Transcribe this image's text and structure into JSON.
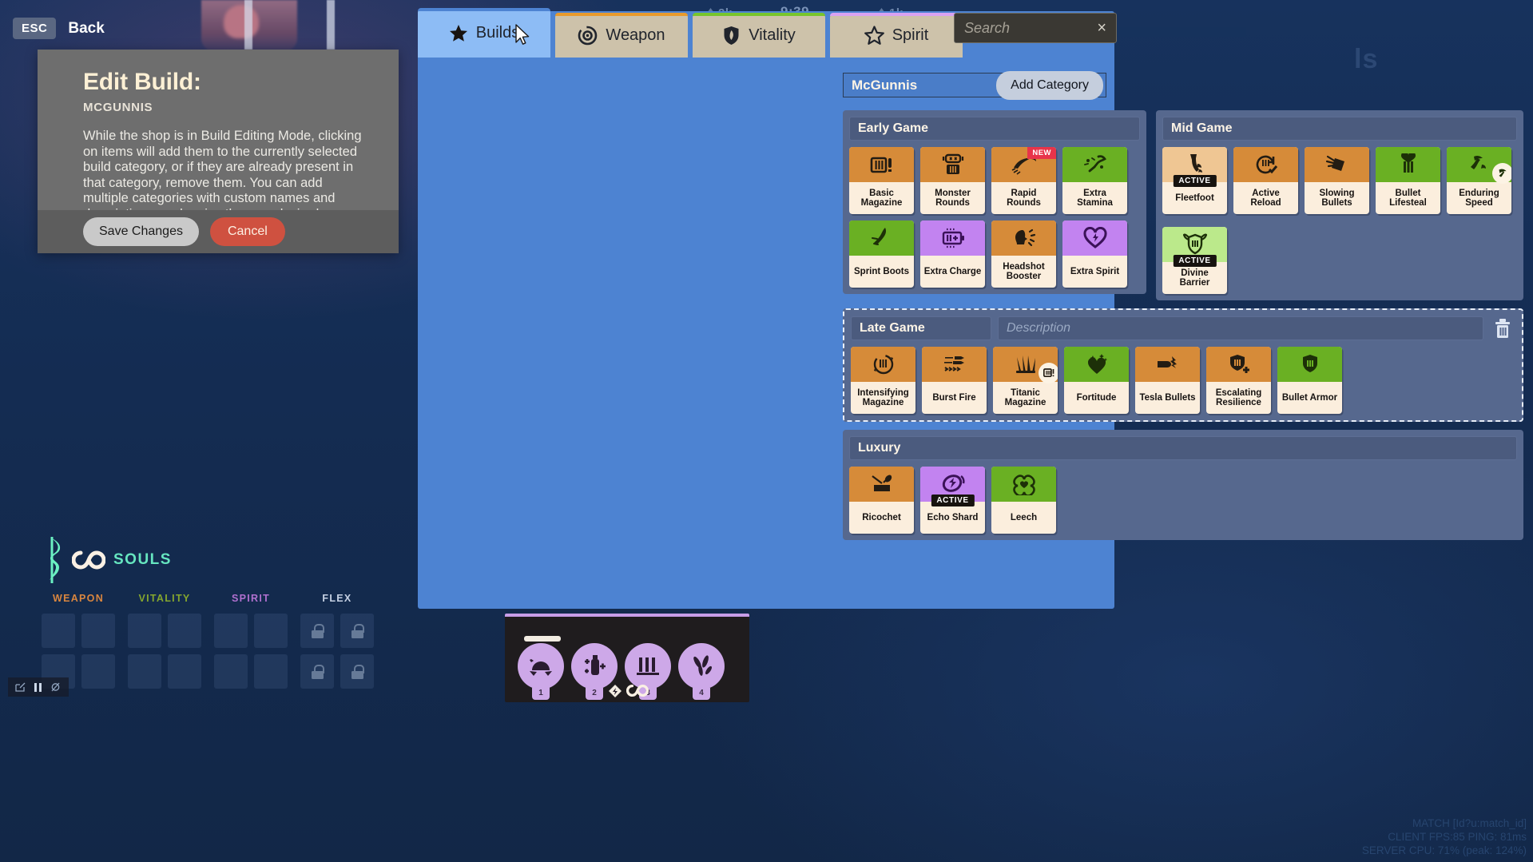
{
  "hud": {
    "souls_left": "2k",
    "souls_right": "1k",
    "clock": "9:39",
    "ghost_text": "ls",
    "souls_label": "SOULS",
    "stat_categories": [
      "WEAPON",
      "VITALITY",
      "SPIRIT",
      "FLEX"
    ],
    "ability_keys": [
      "1",
      "2",
      "3",
      "4"
    ],
    "debug_line1": "MATCH  [Id?u:match_id]",
    "debug_line2": "CLIENT FPS:85   PING: 81ms",
    "debug_line3": "SERVER CPU: 71% (peak: 124%)"
  },
  "escape": {
    "key": "ESC",
    "label": "Back"
  },
  "modal": {
    "title": "Edit Build:",
    "subtitle": "MCGUNNIS",
    "body": "While the shop is in Build Editing Mode, clicking on items will add them to the currently selected build category, or if they are already present in that category, remove them.  You can add multiple categories with custom names and descriptions, and resize them as desired.",
    "save_label": "Save Changes",
    "cancel_label": "Cancel"
  },
  "tabs": [
    {
      "label": "Builds",
      "icon": "star-filled-icon",
      "accent": "#4d83d2",
      "active": true
    },
    {
      "label": "Weapon",
      "icon": "weapon-icon",
      "accent": "#e89a2c",
      "active": false
    },
    {
      "label": "Vitality",
      "icon": "shield-icon",
      "accent": "#77c52c",
      "active": false
    },
    {
      "label": "Spirit",
      "icon": "star-outline-icon",
      "accent": "#d9a2f2",
      "active": false
    }
  ],
  "search": {
    "placeholder": "Search",
    "clear": "×"
  },
  "build": {
    "name": "McGunnis",
    "add_category_label": "Add Category"
  },
  "categories": [
    {
      "title": "Early Game",
      "editing": false,
      "items": [
        {
          "name": "Basic Magazine",
          "type": "weapon",
          "icon": "magazine-icon",
          "badge": ""
        },
        {
          "name": "Monster Rounds",
          "type": "weapon",
          "icon": "monster-icon",
          "badge": ""
        },
        {
          "name": "Rapid Rounds",
          "type": "weapon",
          "icon": "rapid-rounds-icon",
          "badge": "NEW"
        },
        {
          "name": "Extra Stamina",
          "type": "vitality",
          "icon": "stamina-icon",
          "badge": ""
        },
        {
          "name": "Sprint Boots",
          "type": "vitality",
          "icon": "boot-icon",
          "badge": ""
        },
        {
          "name": "Extra Charge",
          "type": "spirit",
          "icon": "battery-plus-icon",
          "badge": ""
        },
        {
          "name": "Headshot Booster",
          "type": "weapon",
          "icon": "headshot-icon",
          "badge": ""
        },
        {
          "name": "Extra Spirit",
          "type": "spirit",
          "icon": "heart-bolt-icon",
          "badge": ""
        }
      ]
    },
    {
      "title": "Mid Game",
      "editing": false,
      "items": [
        {
          "name": "Fleetfoot",
          "type": "weapon_light",
          "icon": "winged-boot-icon",
          "badge": "ACTIVE"
        },
        {
          "name": "Active Reload",
          "type": "weapon",
          "icon": "reload-icon",
          "badge": ""
        },
        {
          "name": "Slowing Bullets",
          "type": "weapon",
          "icon": "slowing-boot-icon",
          "badge": ""
        },
        {
          "name": "Bullet Lifesteal",
          "type": "vitality",
          "icon": "lifesteal-icon",
          "badge": ""
        },
        {
          "name": "Enduring Speed",
          "type": "vitality",
          "icon": "winged-foot-icon",
          "badge": "COMPONENT"
        },
        {
          "name": "Divine Barrier",
          "type": "vitality_light",
          "icon": "barrier-icon",
          "badge": "ACTIVE"
        }
      ]
    },
    {
      "title": "Late Game",
      "editing": true,
      "description_placeholder": "Description",
      "trash_icon": "trash-icon",
      "items": [
        {
          "name": "Intensifying Magazine",
          "type": "weapon",
          "icon": "intensify-mag-icon",
          "badge": ""
        },
        {
          "name": "Burst Fire",
          "type": "weapon",
          "icon": "burst-fire-icon",
          "badge": ""
        },
        {
          "name": "Titanic Magazine",
          "type": "weapon",
          "icon": "titanic-mag-icon",
          "badge": "COMPONENT"
        },
        {
          "name": "Fortitude",
          "type": "vitality",
          "icon": "sparkle-heart-icon",
          "badge": ""
        },
        {
          "name": "Tesla Bullets",
          "type": "weapon",
          "icon": "tesla-bullet-icon",
          "badge": ""
        },
        {
          "name": "Escalating Resilience",
          "type": "weapon",
          "icon": "shield-plus-icon",
          "badge": ""
        },
        {
          "name": "Bullet Armor",
          "type": "vitality",
          "icon": "bullet-armor-icon",
          "badge": ""
        }
      ]
    },
    {
      "title": "Luxury",
      "editing": false,
      "items": [
        {
          "name": "Ricochet",
          "type": "weapon",
          "icon": "ricochet-icon",
          "badge": ""
        },
        {
          "name": "Echo Shard",
          "type": "spirit",
          "icon": "echo-shard-icon",
          "badge": "ACTIVE"
        },
        {
          "name": "Leech",
          "type": "vitality",
          "icon": "leech-icon",
          "badge": ""
        }
      ]
    }
  ],
  "colors": {
    "weapon": "#d68b39",
    "vitality": "#6ab023",
    "spirit": "#c283f0",
    "panel": "#4d83d2",
    "category": "#56688e",
    "accent_new": "#e8344a"
  }
}
